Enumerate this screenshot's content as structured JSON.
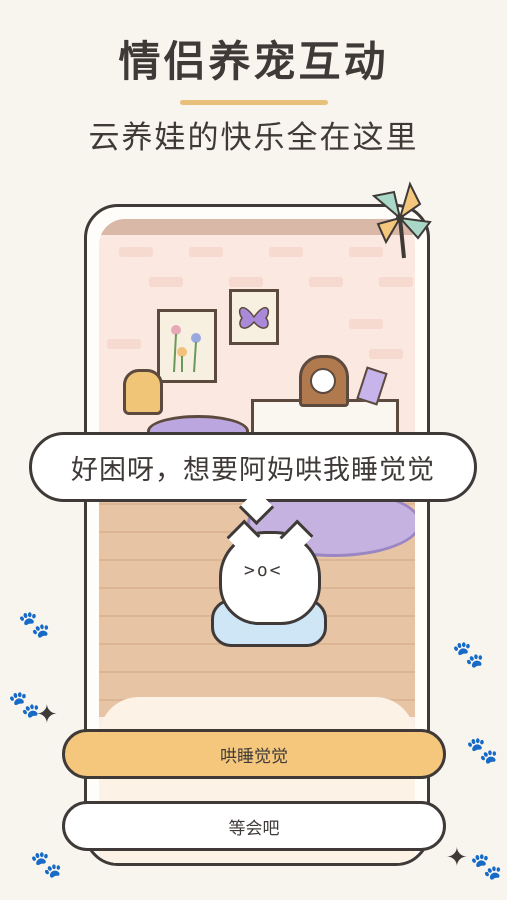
{
  "header": {
    "title": "情侣养宠互动",
    "subtitle": "云养娃的快乐全在这里"
  },
  "scene": {
    "speech": "好困呀，想要阿妈哄我睡觉觉"
  },
  "actions": {
    "primary_label": "哄睡觉觉",
    "secondary_label": "等会吧"
  },
  "colors": {
    "accent": "#f4c77c",
    "background": "#f8f5ef",
    "outline": "#3f3a38"
  },
  "icons": [
    "pinwheel-icon",
    "sparkle-icon",
    "paw-icon"
  ]
}
